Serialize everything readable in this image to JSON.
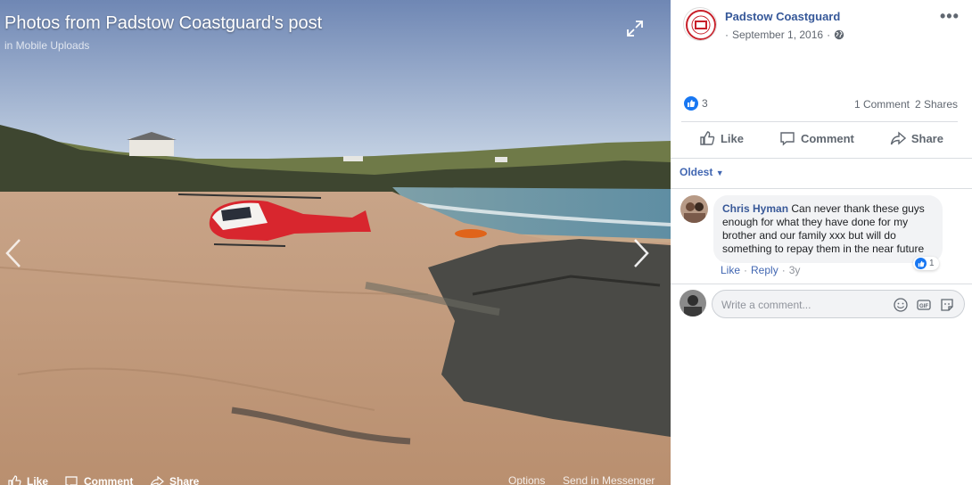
{
  "viewer": {
    "title": "Photos from Padstow Coastguard's post",
    "album": "in Mobile Uploads",
    "icons": {
      "expand": "expand-icon",
      "prev": "chevron-left-icon",
      "next": "chevron-right-icon"
    },
    "bottom_bar": {
      "like_label": "Like",
      "comment_label": "Comment",
      "share_label": "Share",
      "options_label": "Options",
      "send_label": "Send in Messenger"
    }
  },
  "post": {
    "page_name": "Padstow Coastguard",
    "date": "September 1, 2016",
    "separator": "·",
    "privacy_icon": "globe-icon",
    "reaction_count": "3",
    "comments_count": "1 Comment",
    "shares_count": "2 Shares",
    "actions": {
      "like": "Like",
      "comment": "Comment",
      "share": "Share"
    },
    "sort_label": "Oldest",
    "brand_color": "#4267b2",
    "like_color": "#1877f2"
  },
  "comments": [
    {
      "author": "Chris Hyman",
      "text": "Can never thank these guys enough for what they have done for my brother and our family xxx but will do something to repay them in the near future",
      "reaction_count": "1",
      "like_label": "Like",
      "reply_label": "Reply",
      "age": "3y"
    }
  ],
  "composer": {
    "placeholder": "Write a comment...",
    "icons": [
      "emoji-icon",
      "gif-icon",
      "sticker-icon"
    ]
  }
}
